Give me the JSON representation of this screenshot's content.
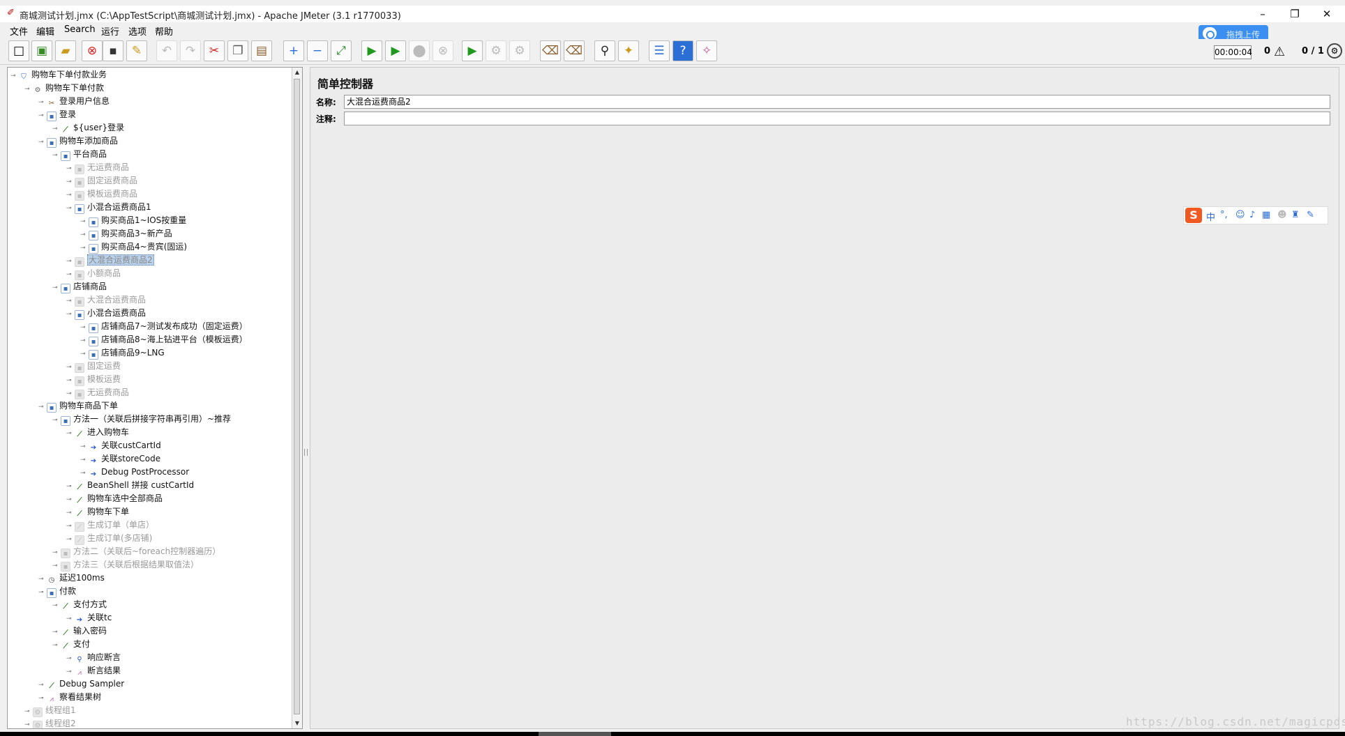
{
  "window": {
    "title": "商城测试计划.jmx (C:\\AppTestScript\\商城测试计划.jmx) - Apache JMeter (3.1 r1770033)",
    "minimize": "–",
    "maximize": "❐",
    "close": "✕"
  },
  "menu": [
    "文件",
    "编辑",
    "Search",
    "运行",
    "选项",
    "帮助"
  ],
  "upload_button": "拖拽上传",
  "toolbar": {
    "timer": "00:00:04",
    "error_count": "0",
    "threads": "0 / 1"
  },
  "tree": [
    {
      "label": "购物车下单付款业务",
      "icon": "plan-icon",
      "level": 0,
      "disabled": false
    },
    {
      "label": "购物车下单付款",
      "icon": "gear-icon",
      "level": 1,
      "disabled": false
    },
    {
      "label": "登录用户信息",
      "icon": "tool-icon",
      "level": 2,
      "disabled": false
    },
    {
      "label": "登录",
      "icon": "controller-icon",
      "level": 2,
      "disabled": false
    },
    {
      "label": "${user}登录",
      "icon": "sampler-icon",
      "level": 3,
      "disabled": false
    },
    {
      "label": "购物车添加商品",
      "icon": "controller-icon",
      "level": 2,
      "disabled": false
    },
    {
      "label": "平台商品",
      "icon": "controller-icon",
      "level": 3,
      "disabled": false
    },
    {
      "label": "无运费商品",
      "icon": "controller-icon",
      "level": 4,
      "disabled": true
    },
    {
      "label": "固定运费商品",
      "icon": "controller-icon",
      "level": 4,
      "disabled": true
    },
    {
      "label": "模板运费商品",
      "icon": "controller-icon",
      "level": 4,
      "disabled": true
    },
    {
      "label": "小混合运费商品1",
      "icon": "controller-icon",
      "level": 4,
      "disabled": false
    },
    {
      "label": "购买商品1~IOS按重量",
      "icon": "controller-icon",
      "level": 5,
      "disabled": false
    },
    {
      "label": "购买商品3~新产品",
      "icon": "controller-icon",
      "level": 5,
      "disabled": false
    },
    {
      "label": "购买商品4~贵宾(固运)",
      "icon": "controller-icon",
      "level": 5,
      "disabled": false
    },
    {
      "label": "大混合运费商品2",
      "icon": "controller-icon",
      "level": 4,
      "disabled": true,
      "selected": true
    },
    {
      "label": "小额商品",
      "icon": "controller-icon",
      "level": 4,
      "disabled": true
    },
    {
      "label": "店铺商品",
      "icon": "controller-icon",
      "level": 3,
      "disabled": false
    },
    {
      "label": "大混合运费商品",
      "icon": "controller-icon",
      "level": 4,
      "disabled": true
    },
    {
      "label": "小混合运费商品",
      "icon": "controller-icon",
      "level": 4,
      "disabled": false
    },
    {
      "label": "店铺商品7~测试发布成功（固定运费）",
      "icon": "controller-icon",
      "level": 5,
      "disabled": false
    },
    {
      "label": "店铺商品8~海上钻进平台（模板运费）",
      "icon": "controller-icon",
      "level": 5,
      "disabled": false
    },
    {
      "label": "店铺商品9~LNG",
      "icon": "controller-icon",
      "level": 5,
      "disabled": false
    },
    {
      "label": "固定运费",
      "icon": "controller-icon",
      "level": 4,
      "disabled": true
    },
    {
      "label": "模板运费",
      "icon": "controller-icon",
      "level": 4,
      "disabled": true
    },
    {
      "label": "无运费商品",
      "icon": "controller-icon",
      "level": 4,
      "disabled": true
    },
    {
      "label": "购物车商品下单",
      "icon": "controller-icon",
      "level": 2,
      "disabled": false
    },
    {
      "label": "方法一（关联后拼接字符串再引用）~推荐",
      "icon": "controller-icon",
      "level": 3,
      "disabled": false
    },
    {
      "label": "进入购物车",
      "icon": "sampler-icon",
      "level": 4,
      "disabled": false
    },
    {
      "label": "关联custCartId",
      "icon": "postprocessor-icon",
      "level": 5,
      "disabled": false
    },
    {
      "label": "关联storeCode",
      "icon": "postprocessor-icon",
      "level": 5,
      "disabled": false
    },
    {
      "label": "Debug PostProcessor",
      "icon": "postprocessor-icon",
      "level": 5,
      "disabled": false
    },
    {
      "label": "BeanShell 拼接 custCartId",
      "icon": "sampler-icon",
      "level": 4,
      "disabled": false
    },
    {
      "label": "购物车选中全部商品",
      "icon": "sampler-icon",
      "level": 4,
      "disabled": false
    },
    {
      "label": "购物车下单",
      "icon": "sampler-icon",
      "level": 4,
      "disabled": false
    },
    {
      "label": "生成订单（单店）",
      "icon": "sampler-icon",
      "level": 4,
      "disabled": true
    },
    {
      "label": "生成订单(多店铺)",
      "icon": "sampler-icon",
      "level": 4,
      "disabled": true
    },
    {
      "label": "方法二（关联后~foreach控制器遍历）",
      "icon": "controller-icon",
      "level": 3,
      "disabled": true
    },
    {
      "label": "方法三（关联后根据结果取值法）",
      "icon": "controller-icon",
      "level": 3,
      "disabled": true
    },
    {
      "label": "延迟100ms",
      "icon": "timer-icon",
      "level": 2,
      "disabled": false
    },
    {
      "label": "付款",
      "icon": "controller-icon",
      "level": 2,
      "disabled": false
    },
    {
      "label": "支付方式",
      "icon": "sampler-icon",
      "level": 3,
      "disabled": false
    },
    {
      "label": "关联tc",
      "icon": "postprocessor-icon",
      "level": 4,
      "disabled": false
    },
    {
      "label": "输入密码",
      "icon": "sampler-icon",
      "level": 3,
      "disabled": false
    },
    {
      "label": "支付",
      "icon": "sampler-icon",
      "level": 3,
      "disabled": false
    },
    {
      "label": "响应断言",
      "icon": "magnifier-icon",
      "level": 4,
      "disabled": false
    },
    {
      "label": "断言结果",
      "icon": "graph-icon",
      "level": 4,
      "disabled": false
    },
    {
      "label": "Debug Sampler",
      "icon": "sampler-icon",
      "level": 2,
      "disabled": false
    },
    {
      "label": "察看结果树",
      "icon": "graph-icon",
      "level": 2,
      "disabled": false
    },
    {
      "label": "线程组1",
      "icon": "gear-icon",
      "level": 1,
      "disabled": true
    },
    {
      "label": "线程组2",
      "icon": "gear-icon",
      "level": 1,
      "disabled": true
    }
  ],
  "panel": {
    "title": "简单控制器",
    "name_label": "名称:",
    "name_value": "大混合运费商品2",
    "comment_label": "注释:",
    "comment_value": ""
  },
  "ime": {
    "logo": "S",
    "mode": "中"
  },
  "watermark": "https://blog.csdn.net/magicpds"
}
